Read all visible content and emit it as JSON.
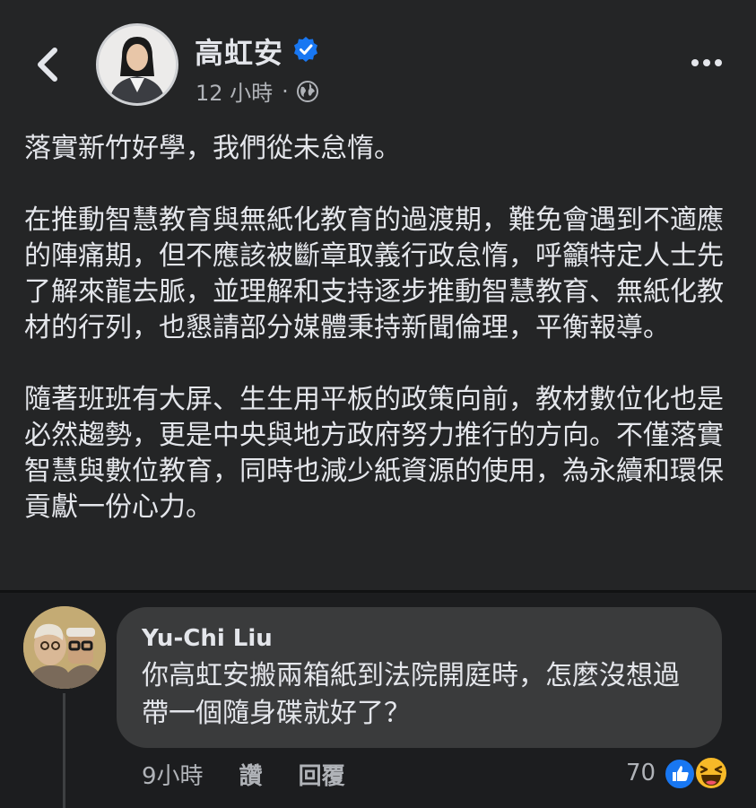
{
  "post": {
    "author_name": "高虹安",
    "timestamp": "12 小時",
    "separator": "·",
    "paragraphs": [
      "落實新竹好學，我們從未怠惰。",
      "在推動智慧教育與無紙化教育的過渡期，難免會遇到不適應的陣痛期，但不應該被斷章取義行政怠惰，呼籲特定人士先了解來龍去脈，並理解和支持逐步推動智慧教育、無紙化教材的行列，也懇請部分媒體秉持新聞倫理，平衡報導。",
      "隨著班班有大屏、生生用平板的政策向前，教材數位化也是必然趨勢，更是中央與地方政府努力推行的方向。不僅落實智慧與數位教育，同時也減少紙資源的使用，為永續和環保貢獻一份心力。"
    ],
    "icons": {
      "back": "back-chevron-icon",
      "verified": "verified-badge-icon",
      "audience": "globe-icon",
      "menu": "more-dots-icon"
    }
  },
  "comment": {
    "author_name": "Yu-Chi Liu",
    "text": "你高虹安搬兩箱紙到法院開庭時，怎麼沒想過帶一個隨身碟就好了？",
    "time": "9小時",
    "like_label": "讚",
    "reply_label": "回覆",
    "reaction_count": "70",
    "reactions": [
      "like-reaction-icon",
      "haha-reaction-icon"
    ]
  },
  "colors": {
    "background": "#242526",
    "bubble": "#3a3b3c",
    "text_primary": "#e4e6eb",
    "text_secondary": "#b0b3b8",
    "accent_blue": "#1877f2",
    "haha_yellow": "#f7b928"
  }
}
